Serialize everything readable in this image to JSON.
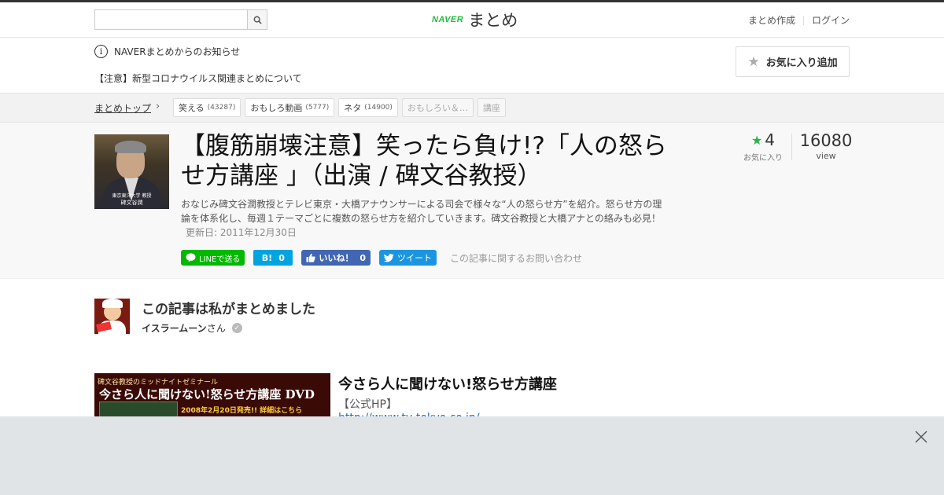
{
  "header": {
    "logo_brand": "NAVER",
    "logo_name": "まとめ",
    "links": [
      "まとめ作成",
      "ログイン"
    ],
    "search_placeholder": ""
  },
  "notice": {
    "label": "NAVERまとめからのお知らせ",
    "link": "【注意】新型コロナウイルス関連まとめについて"
  },
  "breadcrumb": {
    "top": "まとめトップ",
    "tags": [
      {
        "label": "笑える",
        "count": "(43287)"
      },
      {
        "label": "おもしろ動画",
        "count": "(5777)"
      },
      {
        "label": "ネタ",
        "count": "(14900)"
      },
      {
        "label": "おもしろい＆…",
        "count": ""
      },
      {
        "label": "講座",
        "count": ""
      }
    ]
  },
  "article": {
    "title": "【腹筋崩壊注意】笑ったら負け!?「人の怒らせ方講座 」（出演 / 碑文谷教授）",
    "description": "おなじみ碑文谷潤教授とテレビ東京・大橋アナウンサーによる司会で様々な“人の怒らせ方”を紹介。怒らせ方の理論を体系化し、毎週１テーマごとに複数の怒らせ方を紹介していきます。碑文谷教授と大橋アナとの絡みも必見！",
    "updated": "更新日: 2011年12月30日",
    "thumb_caption_1": "東京東洋大学 教授",
    "thumb_caption_2": "碑文谷潤",
    "fav_count": "4",
    "fav_label": "お気に入り",
    "view_count": "16080",
    "view_label": "view",
    "fav_button": "お気に入り追加"
  },
  "share": {
    "line": "LINEで送る",
    "hatena_label": "B!",
    "hatena_count": "0",
    "fb_label": "いいね！",
    "fb_count": "0",
    "tweet": "ツイート",
    "contact": "この記事に関するお問い合わせ"
  },
  "author": {
    "heading": "この記事は私がまとめました",
    "name": "イスラームーン",
    "suffix": "さん"
  },
  "item": {
    "banner_line1": "碑文谷教授のミッドナイトゼミナール",
    "banner_line2": "今さら人に聞けない!怒らせ方講座 DVD",
    "banner_line3": "2008年2月20日発売!! 詳細はこちら",
    "title": "今さら人に聞けない!怒らせ方講座",
    "source": "【公式HP】",
    "link": "http://www.tv-tokyo.co.jp/..."
  },
  "colors": {
    "naver_green": "#1fbd3c",
    "line_green": "#00b900",
    "hatena_blue": "#00a4de",
    "facebook_blue": "#4267b2",
    "twitter_blue": "#1b95e0",
    "star_green": "#27b34b",
    "overlay_gray": "#e1e4e7"
  },
  "icons": [
    "search-icon",
    "info-icon",
    "chevron-right-icon",
    "star-icon",
    "line-icon",
    "facebook-thumb-icon",
    "twitter-bird-icon",
    "verified-check-icon",
    "close-icon"
  ]
}
